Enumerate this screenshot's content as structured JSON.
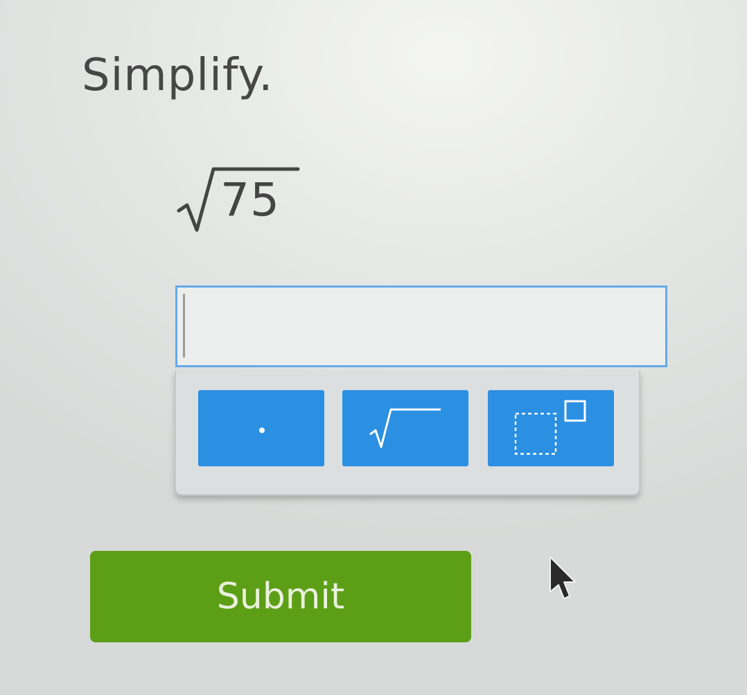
{
  "question": {
    "prompt": "Simplify.",
    "radicand": "75"
  },
  "answer_input": {
    "value": "",
    "placeholder": ""
  },
  "keypad": {
    "keys": [
      {
        "name": "dot",
        "label": "·",
        "icon": "dot-icon"
      },
      {
        "name": "sqrt",
        "label": "√",
        "icon": "square-root-icon"
      },
      {
        "name": "exponent",
        "label": "x²",
        "icon": "exponent-template-icon"
      }
    ]
  },
  "submit": {
    "label": "Submit"
  },
  "colors": {
    "key_blue": "#2b8fe2",
    "submit_green": "#5d9e17",
    "input_border": "#64a9ea"
  },
  "cursor_icon": "mouse-pointer-icon"
}
